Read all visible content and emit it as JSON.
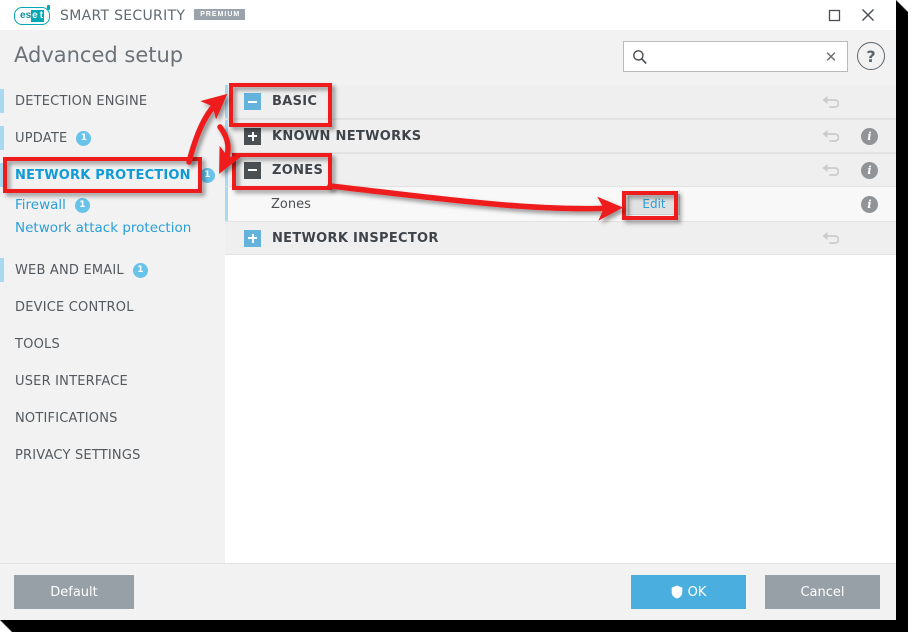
{
  "window": {
    "brand": {
      "logo_text": "eset",
      "product": "SMART SECURITY",
      "edition": "PREMIUM"
    },
    "controls": {
      "maximize": "maximize-button",
      "close": "close-button"
    }
  },
  "header": {
    "title": "Advanced setup",
    "search": {
      "value": "",
      "placeholder": "",
      "clear_label": "✕",
      "icon": "search-icon"
    },
    "help_label": "?"
  },
  "sidebar": {
    "items": [
      {
        "label": "DETECTION ENGINE",
        "badge": null,
        "level": "top",
        "active": false
      },
      {
        "label": "UPDATE",
        "badge": "1",
        "level": "top",
        "active": false
      },
      {
        "label": "NETWORK PROTECTION",
        "badge": "1",
        "level": "top",
        "active": true
      },
      {
        "label": "Firewall",
        "badge": "1",
        "level": "sub",
        "active": false
      },
      {
        "label": "Network attack protection",
        "badge": null,
        "level": "sub",
        "active": false
      },
      {
        "label": "WEB AND EMAIL",
        "badge": "1",
        "level": "top",
        "active": false
      },
      {
        "label": "DEVICE CONTROL",
        "badge": null,
        "level": "top",
        "active": false
      },
      {
        "label": "TOOLS",
        "badge": null,
        "level": "top",
        "active": false
      },
      {
        "label": "USER INTERFACE",
        "badge": null,
        "level": "top",
        "active": false
      },
      {
        "label": "NOTIFICATIONS",
        "badge": null,
        "level": "top",
        "active": false
      },
      {
        "label": "PRIVACY SETTINGS",
        "badge": null,
        "level": "top",
        "active": false
      }
    ]
  },
  "content": {
    "rows": [
      {
        "label": "BASIC",
        "type": "section",
        "expanded": true,
        "toggle_style": "blue",
        "toggle_glyph": "minus",
        "has_revert": true,
        "has_info": false
      },
      {
        "label": "KNOWN NETWORKS",
        "type": "section",
        "expanded": false,
        "toggle_style": "dark",
        "toggle_glyph": "plus",
        "has_revert": true,
        "has_info": true
      },
      {
        "label": "ZONES",
        "type": "section",
        "expanded": true,
        "toggle_style": "dark",
        "toggle_glyph": "minus",
        "has_revert": true,
        "has_info": true
      },
      {
        "label": "Zones",
        "type": "leaf",
        "button_label": "Edit",
        "has_revert": false,
        "has_info": true
      },
      {
        "label": "NETWORK INSPECTOR",
        "type": "section",
        "expanded": false,
        "toggle_style": "blue",
        "toggle_glyph": "plus",
        "has_revert": true,
        "has_info": false
      }
    ]
  },
  "footer": {
    "default_label": "Default",
    "ok_label": "OK",
    "cancel_label": "Cancel"
  },
  "colors": {
    "accent_blue": "#2a9fd8",
    "light_blue": "#a8d9f0",
    "badge_blue": "#67c3ea",
    "ok_blue": "#4aaede",
    "gray_button": "#97a0a7",
    "annotation_red": "#ee1c1c",
    "eset_teal": "#00a7b5"
  },
  "annotations": {
    "boxes": [
      {
        "name": "network-protection-highlight"
      },
      {
        "name": "basic-highlight"
      },
      {
        "name": "zones-highlight"
      },
      {
        "name": "edit-highlight"
      }
    ],
    "arrows": [
      {
        "name": "arrow-to-basic"
      },
      {
        "name": "arrow-to-zones"
      },
      {
        "name": "arrow-to-edit"
      }
    ]
  }
}
